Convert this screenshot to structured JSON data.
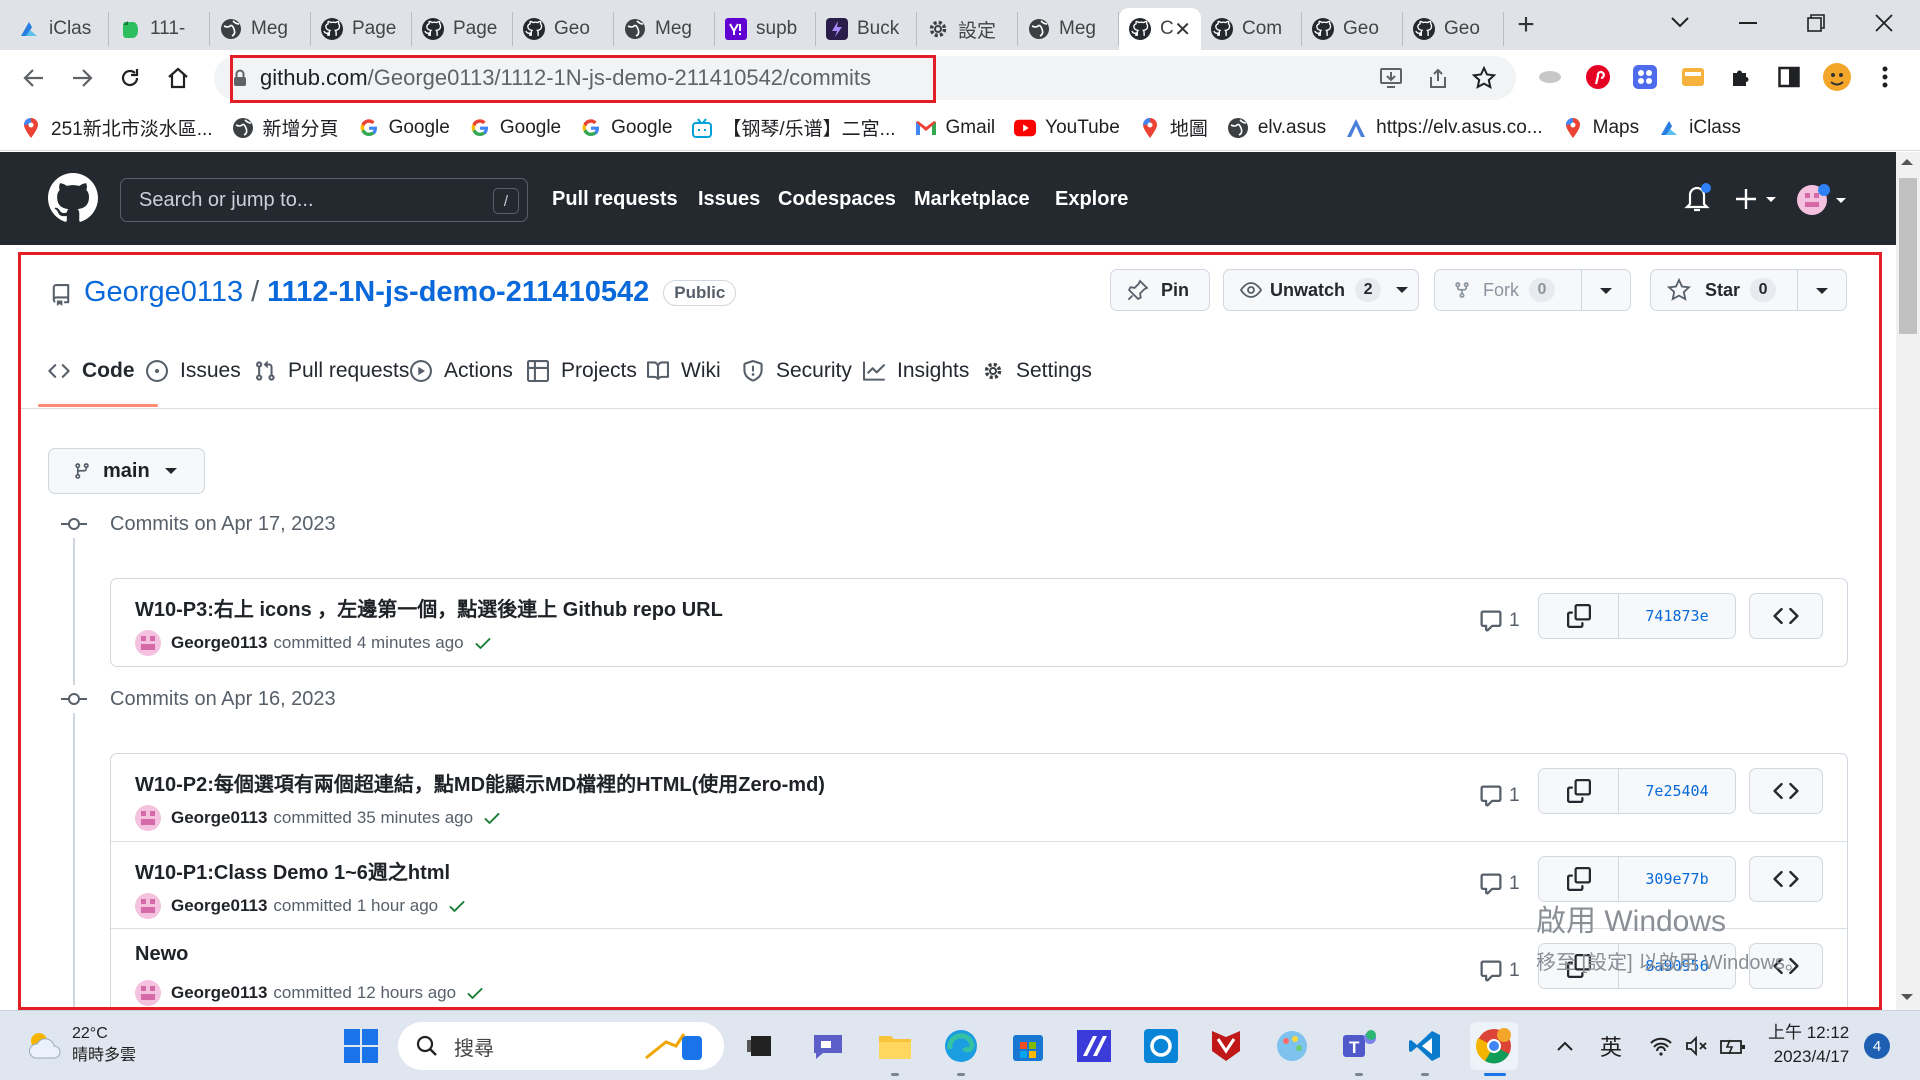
{
  "browser": {
    "tabs": [
      {
        "label": "iClas",
        "icon": "iclass-icon",
        "color": "#2a7de1"
      },
      {
        "label": "111-",
        "icon": "evernote-icon",
        "color": "#2dbe60"
      },
      {
        "label": "Meg",
        "icon": "globe-icon",
        "color": "#333333"
      },
      {
        "label": "Page",
        "icon": "github-icon",
        "color": "#24292f"
      },
      {
        "label": "Page",
        "icon": "github-icon",
        "color": "#24292f"
      },
      {
        "label": "Geo",
        "icon": "github-icon",
        "color": "#24292f"
      },
      {
        "label": "Meg",
        "icon": "globe-icon",
        "color": "#333333"
      },
      {
        "label": "supb",
        "icon": "yahoo-icon",
        "color": "#6001d2"
      },
      {
        "label": "Buck",
        "icon": "bucket-icon",
        "color": "#2b1d49"
      },
      {
        "label": "設定",
        "icon": "gear-icon",
        "color": "#333333"
      },
      {
        "label": "Meg",
        "icon": "globe-icon",
        "color": "#333333"
      },
      {
        "label": "C",
        "icon": "github-icon",
        "color": "#24292f",
        "active": true
      },
      {
        "label": "Com",
        "icon": "github-icon",
        "color": "#24292f"
      },
      {
        "label": "Geo",
        "icon": "github-icon",
        "color": "#24292f"
      },
      {
        "label": "Geo",
        "icon": "github-icon",
        "color": "#24292f"
      }
    ],
    "new_tab": "+",
    "url_host": "github.com",
    "url_path": "/George0113/1112-1N-js-demo-211410542/commits",
    "bookmarks": [
      {
        "label": "251新北市淡水區...",
        "icon": "maps-pin-icon"
      },
      {
        "label": "新增分頁",
        "icon": "globe-icon"
      },
      {
        "label": "Google",
        "icon": "google-icon"
      },
      {
        "label": "Google",
        "icon": "google-icon"
      },
      {
        "label": "Google",
        "icon": "google-icon"
      },
      {
        "label": "【钢琴/乐谱】二宮...",
        "icon": "bilibili-icon"
      },
      {
        "label": "Gmail",
        "icon": "gmail-icon"
      },
      {
        "label": "YouTube",
        "icon": "youtube-icon"
      },
      {
        "label": "地圖",
        "icon": "maps-pin-icon"
      },
      {
        "label": "elv.asus",
        "icon": "globe-icon"
      },
      {
        "label": "https://elv.asus.co...",
        "icon": "asus-icon"
      },
      {
        "label": "Maps",
        "icon": "maps-pin-icon"
      },
      {
        "label": "iClass",
        "icon": "iclass-icon"
      }
    ]
  },
  "github": {
    "search_placeholder": "Search or jump to...",
    "search_key": "/",
    "nav": [
      "Pull requests",
      "Issues",
      "Codespaces",
      "Marketplace",
      "Explore"
    ]
  },
  "repo": {
    "owner": "George0113",
    "separator": "/",
    "name": "1112-1N-js-demo-211410542",
    "visibility": "Public",
    "pin_label": "Pin",
    "watch_label": "Unwatch",
    "watch_count": "2",
    "fork_label": "Fork",
    "fork_count": "0",
    "star_label": "Star",
    "star_count": "0",
    "tabs": [
      {
        "label": "Code",
        "icon": "code-icon",
        "selected": true
      },
      {
        "label": "Issues",
        "icon": "issue-icon"
      },
      {
        "label": "Pull requests",
        "icon": "pull-request-icon"
      },
      {
        "label": "Actions",
        "icon": "play-icon"
      },
      {
        "label": "Projects",
        "icon": "table-icon"
      },
      {
        "label": "Wiki",
        "icon": "book-icon"
      },
      {
        "label": "Security",
        "icon": "shield-icon"
      },
      {
        "label": "Insights",
        "icon": "graph-icon"
      },
      {
        "label": "Settings",
        "icon": "gear-icon"
      }
    ]
  },
  "commits": {
    "branch": "main",
    "groups": [
      {
        "heading": "Commits on Apr 17, 2023",
        "items": [
          {
            "title": "W10-P3:右上 icons ，左邊第一個，點選後連上 Github repo URL",
            "author": "George0113",
            "action": "committed",
            "when": "4 minutes ago",
            "comments": "1",
            "sha": "741873e"
          }
        ]
      },
      {
        "heading": "Commits on Apr 16, 2023",
        "items": [
          {
            "title": "W10-P2:每個選項有兩個超連結，點MD能顯示MD檔裡的HTML(使用Zero-md)",
            "author": "George0113",
            "action": "committed",
            "when": "35 minutes ago",
            "comments": "1",
            "sha": "7e25404"
          },
          {
            "title": "W10-P1:Class Demo 1~6週之html",
            "author": "George0113",
            "action": "committed",
            "when": "1 hour ago",
            "comments": "1",
            "sha": "309e77b"
          },
          {
            "title": "Newo",
            "author": "George0113",
            "action": "committed",
            "when": "12 hours ago",
            "comments": "1",
            "sha": "8a90956"
          }
        ]
      }
    ]
  },
  "watermark": {
    "line1": "啟用 Windows",
    "line2": "移至 [設定] 以啟用 Windows。"
  },
  "taskbar": {
    "temperature": "22°C",
    "weather": "晴時多雲",
    "search_label": "搜尋",
    "ime": "英",
    "time": "上午 12:12",
    "date": "2023/4/17",
    "notifications": "4"
  },
  "colors": {
    "accent_link": "#0969da",
    "highlight_red": "#e41e26",
    "tab_underline": "#fd8c73",
    "check_green": "#1a7f37"
  }
}
